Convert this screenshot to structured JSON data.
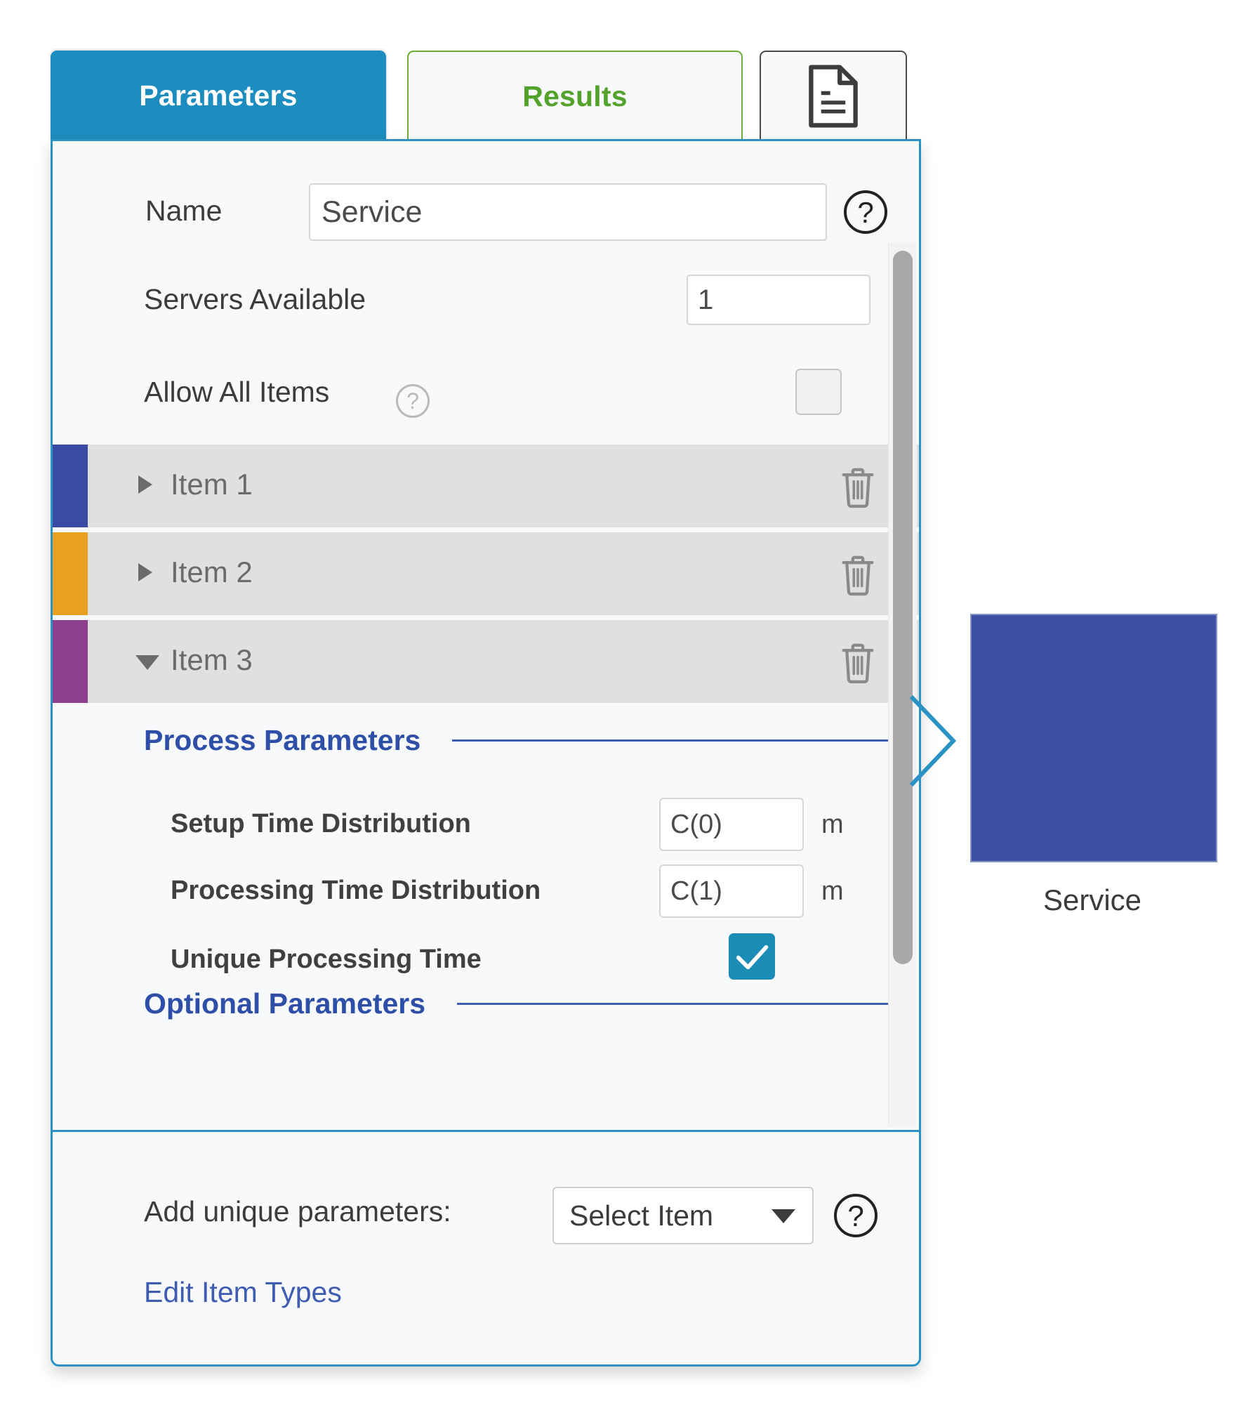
{
  "tabs": [
    {
      "id": "parameters",
      "label": "Parameters",
      "state": "active",
      "color": "#1C8DBE"
    },
    {
      "id": "results",
      "label": "Results",
      "state": "inactive",
      "color": "#53a22b"
    },
    {
      "id": "document",
      "label": "",
      "state": "inactive",
      "icon": "document-icon"
    }
  ],
  "panel": {
    "name": {
      "label": "Name",
      "value": "Service",
      "help": "?"
    },
    "servers": {
      "label": "Servers Available",
      "value": "1"
    },
    "allow_all": {
      "label": "Allow All Items",
      "help": "?",
      "checked": false
    },
    "items": [
      {
        "label": "Item 1",
        "color": "#3b4ba5",
        "expanded": false,
        "delete_icon": "trash-icon"
      },
      {
        "label": "Item 2",
        "color": "#e9a220",
        "expanded": false,
        "delete_icon": "trash-icon"
      },
      {
        "label": "Item 3",
        "color": "#8c3f8c",
        "expanded": true,
        "delete_icon": "trash-icon"
      }
    ],
    "process_section": {
      "title": "Process Parameters",
      "rows": [
        {
          "label": "Setup Time Distribution",
          "value": "C(0)",
          "unit": "m"
        },
        {
          "label": "Processing Time Distribution",
          "value": "C(1)",
          "unit": "m"
        }
      ],
      "unique_processing_time": {
        "label": "Unique Processing Time",
        "checked": true
      }
    },
    "optional_section": {
      "title": "Optional Parameters"
    },
    "footer": {
      "add_unique_label": "Add unique parameters:",
      "select_value": "Select Item",
      "select_help": "?",
      "edit_link": "Edit Item Types"
    }
  },
  "canvas": {
    "block": {
      "label": "Service",
      "color": "#3b4fa3"
    },
    "connector": "chevron-right-connector"
  },
  "colors": {
    "accent_blue": "#2a93c4",
    "section_blue": "#2e4fa8",
    "results_green": "#53a22b",
    "checkbox_blue": "#1b8cb5"
  }
}
